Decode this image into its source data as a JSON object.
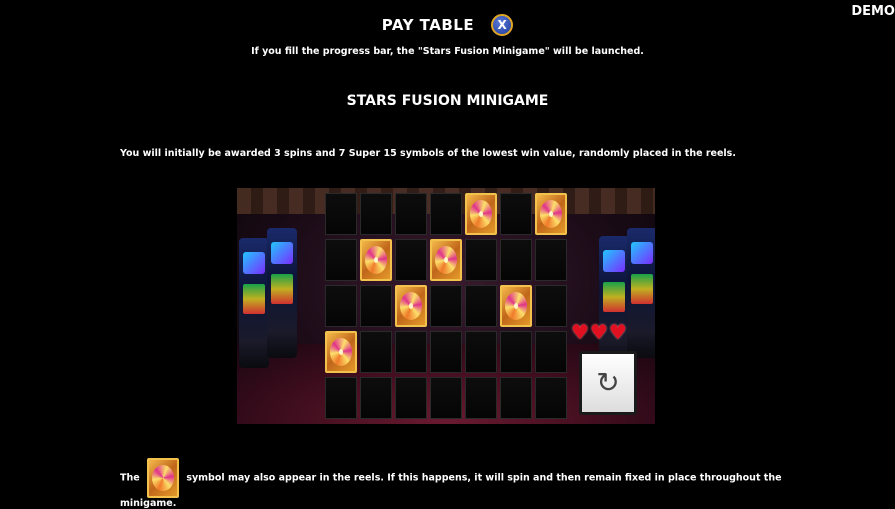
{
  "demo_label": "DEMO",
  "header": {
    "title": "PAY TABLE",
    "close_label": "X"
  },
  "intro_text": "If you fill the progress bar, the \"Stars Fusion Minigame\" will be launched.",
  "section_title": "STARS FUSION MINIGAME",
  "description": "You will initially be awarded 3 spins and 7 Super 15 symbols of the lowest win value, randomly placed in the reels.",
  "grid": {
    "rows": 5,
    "cols": 7,
    "symbol_positions": [
      [
        0,
        4
      ],
      [
        0,
        6
      ],
      [
        1,
        1
      ],
      [
        1,
        3
      ],
      [
        2,
        2
      ],
      [
        2,
        5
      ],
      [
        3,
        0
      ]
    ]
  },
  "hearts": {
    "count": 3,
    "icon": "heart-icon",
    "color": "#e01020"
  },
  "respin_icon": "refresh-icon",
  "footer": {
    "before": "The",
    "after": "symbol may also appear in the reels. If this happens, it will spin and then remain fixed in place throughout the minigame."
  }
}
